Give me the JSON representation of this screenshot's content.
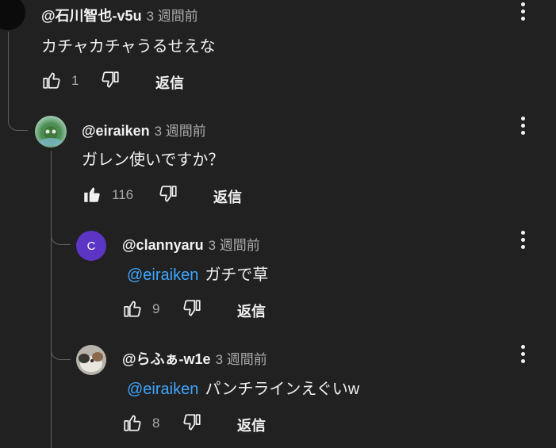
{
  "comments": [
    {
      "author": "@石川智也-v5u",
      "time": "3 週間前",
      "text": "カチャカチャうるせえな",
      "mention": "",
      "likes": "1",
      "reply_label": "返信"
    },
    {
      "author": "@eiraiken",
      "time": "3 週間前",
      "text": "ガレン使いですか？",
      "mention": "",
      "likes": "116",
      "reply_label": "返信"
    },
    {
      "author": "@clannyaru",
      "time": "3 週間前",
      "text": "ガチで草",
      "mention": "@eiraiken",
      "likes": "9",
      "reply_label": "返信",
      "avatar_letter": "C"
    },
    {
      "author": "@らふぁ-w1e",
      "time": "3 週間前",
      "text": "パンチラインえぐいw",
      "mention": "@eiraiken",
      "likes": "8",
      "reply_label": "返信"
    }
  ],
  "colors": {
    "background": "#212121",
    "mention": "#3ea6ff",
    "secondary_text": "#aaaaaa",
    "avatar_purple": "#5c35c4"
  }
}
